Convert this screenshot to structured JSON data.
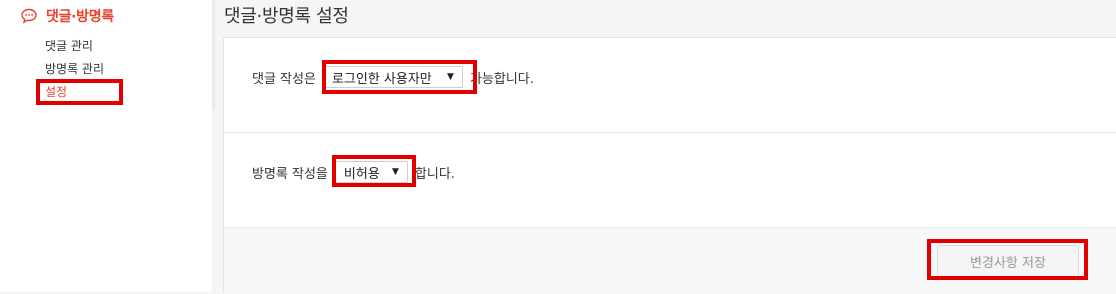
{
  "sidebar": {
    "section_title": "댓글·방명록",
    "section_icon": "speech-bubble-icon",
    "items": [
      {
        "label": "댓글 관리"
      },
      {
        "label": "방명록 관리"
      },
      {
        "label": "설정",
        "active": true
      }
    ],
    "accent_color": "#e8412e"
  },
  "page": {
    "title": "댓글·방명록 설정"
  },
  "settings": {
    "comment": {
      "prefix": "댓글 작성은",
      "selected": "로그인한 사용자만",
      "suffix": "가능합니다."
    },
    "guestbook": {
      "prefix": "방명록 작성을",
      "selected": "비허용",
      "suffix": "합니다."
    }
  },
  "actions": {
    "save_label": "변경사항 저장"
  },
  "highlight_color": "#e00000"
}
